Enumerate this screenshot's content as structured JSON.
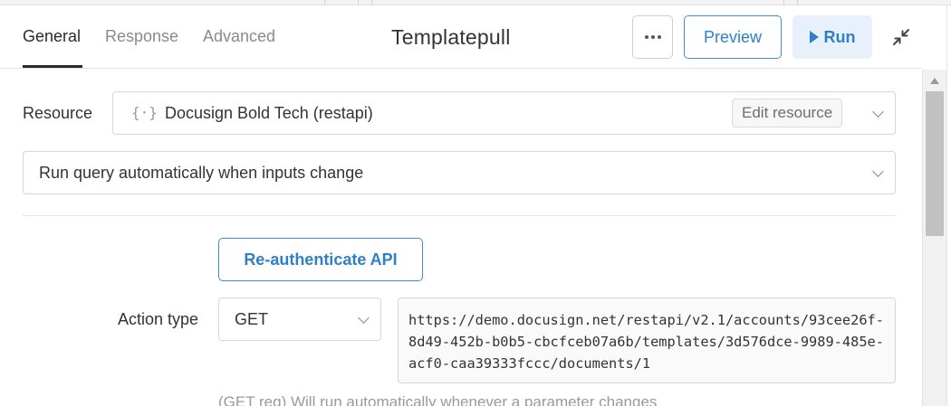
{
  "header": {
    "tabs": [
      {
        "label": "General",
        "active": true
      },
      {
        "label": "Response",
        "active": false
      },
      {
        "label": "Advanced",
        "active": false
      }
    ],
    "title": "Templatepull",
    "more_icon": "ellipsis-icon",
    "preview_label": "Preview",
    "run_label": "Run",
    "run_icon": "play-icon",
    "collapse_icon": "collapse-arrows-icon"
  },
  "resource": {
    "label": "Resource",
    "icon": "api-braces-icon",
    "value": "Docusign Bold Tech (restapi)",
    "edit_label": "Edit resource"
  },
  "trigger": {
    "value": "Run query automatically when inputs change"
  },
  "reauth_label": "Re-authenticate API",
  "action": {
    "label": "Action type",
    "method": "GET",
    "url": "https://demo.docusign.net/restapi/v2.1/accounts/93cee26f-8d49-452b-b0b5-cbcfceb07a6b/templates/3d576dce-9989-485e-acf0-caa39333fccc/documents/1",
    "hint": "(GET req) Will run automatically whenever a parameter changes"
  },
  "colors": {
    "accent": "#2f80c9",
    "run_bg": "#e8f1fb"
  }
}
